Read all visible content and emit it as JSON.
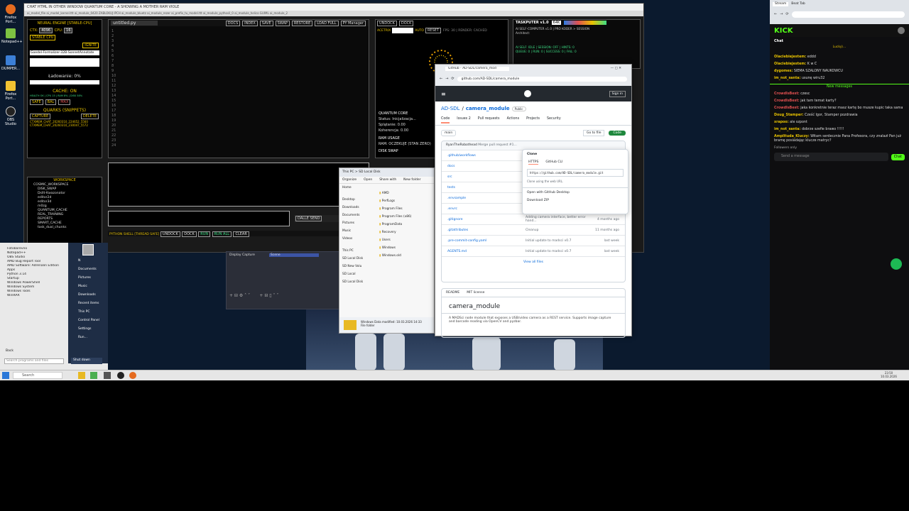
{
  "desktop_icons": [
    {
      "label": "Firefox Port...",
      "icon": "firefox-icon"
    },
    {
      "label": "Notepad++",
      "icon": "notepad-icon"
    },
    {
      "label": "DUMPER...",
      "icon": "app-icon"
    },
    {
      "label": "Firefox Port...",
      "icon": "folder-icon"
    },
    {
      "label": "OBS Studio",
      "icon": "obs-icon"
    }
  ],
  "mainwin": {
    "title": "CHAT HTML IN OTHER WINDOW QUANTUM CORE - A SHOWING A MOTHER RAM VIOLE",
    "tabs": "ai_model_file   ai_model_kernel.ttt   ai_module_0420   ZABLOKUJ IPCH   ai_module_bluetz   ai_module_rezer   ai_prefix_tu_model.ttt   ai_module_pythosil_0   ai_module_helico   GUIML   ai_module_2"
  },
  "neural": {
    "header": "NEURAL ENGINE [STABLE-CPU]",
    "ctx_label": "CTX:",
    "ctx_val": "4096",
    "cpu_label": "CPU:",
    "cpu_val": "16",
    "stable_btn": "STABLE CPU",
    "ignite": "IGNITE",
    "model": "Goedel-Formalizer-32B-SonnetAnnotate",
    "loading": "Ładowanie: 0%",
    "cache_label": "CACHE: ON",
    "cache_row": "HEALTH OK | CPU 15 | RAM 8% | DISK 58%",
    "safe": "SAFE",
    "bal": "BAL",
    "max": "MAX",
    "quarks": "QUARKS (SNIPPETS)",
    "capture": "CAPTURE",
    "delete": "DELETE",
    "files": [
      "CTXMEM_CHAT_20260310_224652_5560",
      "CTXMEM_CHAT_20260310_230047_5572"
    ]
  },
  "workspace": {
    "title": "WORKSPACE",
    "items": [
      "COSMIC_WORKSPACE",
      "DISK_SWAP",
      "Dsllt-Kwazonator",
      "editor2d",
      "editor3d",
      "m0zg",
      "QUANTUM_CACHE",
      "REAL_TRAINING",
      "REPORTS",
      "SMART_CACHE",
      "task_dual_chunks"
    ]
  },
  "editor": {
    "filename": "untitled.py",
    "toolbar": [
      "DOCS",
      "INDEX",
      "SAVE",
      "SWAP",
      "RESTORE",
      "LOAD FULL",
      "PY Manager"
    ],
    "lines": [
      "1",
      "2",
      "3",
      "4",
      "5",
      "6",
      "7",
      "8",
      "9",
      "10",
      "11",
      "12",
      "13",
      "14",
      "15",
      "16",
      "17",
      "18",
      "19",
      "20",
      "21",
      "22",
      "23",
      "24"
    ]
  },
  "shell": {
    "label": "PYTHON SHELL [THREAD SAFE]",
    "buttons": [
      "UNDOCK",
      "DOCK",
      "RUN",
      "RUN ALL",
      "CLEAR"
    ],
    "send_label": "DALLE SEND"
  },
  "quantum": {
    "undock": "UNDOCK",
    "dock": "DOCK",
    "acetrix": "ACETRIX",
    "auto": "AUTO",
    "reset": "RESET",
    "fps": "FPS: 30 | RENDER: CACHED",
    "core_title": "QUANTUM CORE",
    "status": "Status: Inicjalizacja...",
    "splatanie": "Splątanie: 0.00",
    "koherencja": "Koherencja: 0.00",
    "ram_title": "RAM USAGE",
    "ram_status": "RAM: OCZEKUJE (STAN ZERO)",
    "disk_title": "DISK SWAP"
  },
  "taskputer": {
    "title": "TASKPUTER v1.0",
    "val": "64K",
    "line1": "AI SELF-COMPUTER v1.0 | PRO KODER > SESSION",
    "line2": "Architect:",
    "line3": "AI SELF: IDLE | SESSION: OFF | HINTS: 0",
    "line4": "QUEUE: 0 | RUN: 0 | SUCCESS: 0 | FAIL: 0"
  },
  "startmenu": {
    "apps": [
      "Fotobarevno",
      "Notepad++",
      "OBS Studio",
      "AMD Bug Report Tool",
      "AMD Software: Adrenalin Edition",
      "Apps",
      "Python 3.14",
      "Startup",
      "Windows PowerShell",
      "Windows System",
      "Windows Tools",
      "WinRAR"
    ],
    "right": [
      "N",
      "Documents",
      "Pictures",
      "Music",
      "Downloads",
      "Recent items",
      "This PC",
      "Control Panel",
      "Settings",
      "Run..."
    ],
    "back": "Back",
    "search": "Search programs and files",
    "shutdown": "Shut down"
  },
  "taskbar": {
    "search": "Search",
    "time": "23:50",
    "date": "10.03.2026"
  },
  "obs": {
    "label": "Display Capture",
    "source": "Scene"
  },
  "explorer": {
    "path": "This PC > SD Local Disk",
    "org": "Organize",
    "open": "Open",
    "share": "Share with",
    "new": "New folder",
    "nav": [
      "Home",
      "Desktop",
      "Downloads",
      "Documents",
      "Pictures",
      "Music",
      "Videos"
    ],
    "folders": [
      "AMD",
      "PerfLogs",
      "Program Files",
      "Program Files (x86)",
      "ProgramData",
      "Recovery",
      "Users",
      "Windows",
      "Windows.old"
    ],
    "tree": [
      "This PC",
      "SD Local Disk",
      "SD New Volu",
      "SD Local",
      "SD Local Disk"
    ],
    "status": "Windows Data modified: 10.03.2026 14:33",
    "status2": "File folder"
  },
  "github": {
    "tab": "GitHub - AD-SDL/camera_mod",
    "url": "github.com/AD-SDL/camera_module",
    "signin": "Sign in",
    "repo_owner": "AD-SDL",
    "repo_name": "camera_module",
    "visibility": "Public",
    "nav": [
      "Code",
      "Issues",
      "Pull requests",
      "Actions",
      "Projects",
      "Security"
    ],
    "issues_count": "2",
    "branch": "main",
    "goto": "Go to file",
    "code_btn": "Code",
    "commit_user": "RyanTheRobothead",
    "commit_msg": "Merge pull request #1...",
    "files": [
      {
        "name": ".github/workflows",
        "msg": "",
        "time": ""
      },
      {
        "name": "docs",
        "msg": "",
        "time": ""
      },
      {
        "name": "src",
        "msg": "",
        "time": ""
      },
      {
        "name": "tests",
        "msg": "",
        "time": ""
      },
      {
        "name": ".envsample",
        "msg": "",
        "time": ""
      },
      {
        "name": ".envrc",
        "msg": "Initial update to madsci v0.7",
        "time": "last week"
      },
      {
        "name": ".gitignore",
        "msg": "Adding camera interface, better error hand...",
        "time": "4 months ago"
      },
      {
        "name": ".gitattributes",
        "msg": "Cleanup",
        "time": "11 months ago"
      },
      {
        "name": ".pre-commit-config.yaml",
        "msg": "Initial update to madsci v0.7",
        "time": "last week"
      },
      {
        "name": "AGENTS.md",
        "msg": "Initial update to madsci v0.7",
        "time": "last week"
      }
    ],
    "view_all": "View all files",
    "readme_tab": "README",
    "license_tab": "MIT license",
    "readme_title": "camera_module",
    "readme_text": "A MADSci node module that exposes a USB/video camera as a REST service. Supports image capture and barcode reading via OpenCV and pyzbar.",
    "clone": {
      "title": "Clone",
      "https": "HTTPS",
      "cli": "GitHub CLI",
      "url": "https://github.com/AD-SDL/camera_module.git",
      "hint": "Clone using the web URL.",
      "desktop": "Open with GitHub Desktop",
      "zip": "Download ZIP"
    }
  },
  "kick": {
    "tab1": "Stream",
    "tab2": "Beat Tab",
    "logo": "KICK",
    "chat_title": "Chat",
    "pinned": "Lucky\\...",
    "messages": [
      {
        "user": "Olaciebiejestem:",
        "text": "eddd",
        "color": "#e8c200"
      },
      {
        "user": "Olaciebiejestem:",
        "text": "K w C",
        "color": "#e8c200"
      },
      {
        "user": "dygomes:",
        "text": "SIEMA SZALONY NAUKOWCU",
        "color": "#e8c200"
      },
      {
        "user": "im_not_santa:",
        "text": "usunę wiru32",
        "color": "#e8c200"
      }
    ],
    "new_messages": "New messages",
    "messages2": [
      {
        "user": "CrowdIsBest:",
        "text": "czesc",
        "color": "#e05050"
      },
      {
        "user": "CrowdIsBest:",
        "text": "jak tam temat karty?",
        "color": "#e05050"
      },
      {
        "user": "CrowdIsBest:",
        "text": "jaka konkretnie teraz masz kartę bo musze kupic taka sama",
        "color": "#e05050"
      },
      {
        "user": "Doug_Stamper:",
        "text": "Cześć Igor, Stamper pozdrawia",
        "color": "#e8c200"
      },
      {
        "user": "xrapoo:",
        "text": "ale szpont",
        "color": "#e8c200"
      },
      {
        "user": "im_not_santa:",
        "text": "dobrze szefie brawo !!!!!",
        "color": "#e8c200"
      },
      {
        "user": "Amplituda_Kluczy:",
        "text": "Witam serdecznie Pana Profesora, czy znalazł Pan już bramę posiadając klucze matryc?",
        "color": "#e8c200"
      }
    ],
    "followers": "Followers only",
    "send_placeholder": "Send a message",
    "chat_btn": "Chat"
  }
}
